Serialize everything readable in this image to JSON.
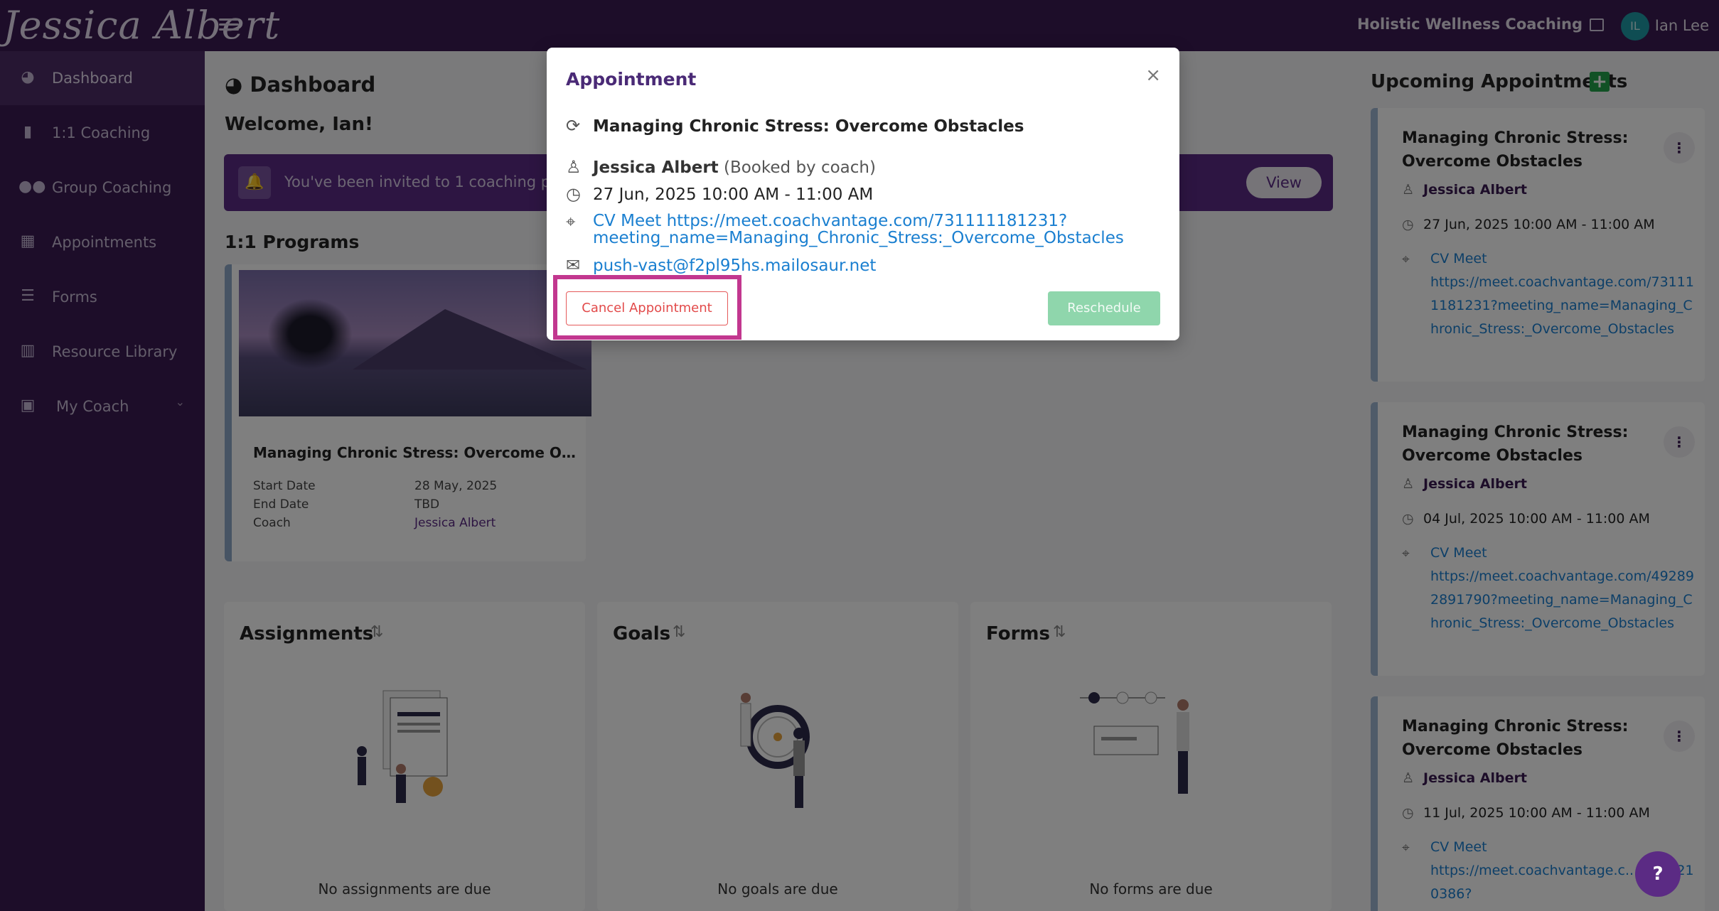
{
  "topbar": {
    "logo_text": "Jessica Albert",
    "org_name": "Holistic Wellness Coaching",
    "avatar_initials": "IL",
    "user_name": "Ian Lee"
  },
  "sidebar": {
    "items": [
      {
        "label": "Dashboard",
        "icon": "dashboard-icon"
      },
      {
        "label": "1:1 Coaching",
        "icon": "book-icon"
      },
      {
        "label": "Group Coaching",
        "icon": "group-icon"
      },
      {
        "label": "Appointments",
        "icon": "calendar-icon"
      },
      {
        "label": "Forms",
        "icon": "list-icon"
      },
      {
        "label": "Resource Library",
        "icon": "library-icon"
      },
      {
        "label": "My Coach",
        "icon": "coach-icon"
      }
    ]
  },
  "main": {
    "title": "Dashboard",
    "welcome": "Welcome, Ian!",
    "invite_message": "You've been invited to 1 coaching pr",
    "invite_button": "View",
    "programs_title": "1:1 Programs",
    "program": {
      "name": "Managing Chronic Stress: Overcome Obst...",
      "start_label": "Start Date",
      "start_value": "28 May, 2025",
      "end_label": "End Date",
      "end_value": "TBD",
      "coach_label": "Coach",
      "coach_value": "Jessica Albert"
    },
    "panels": {
      "assignments": {
        "title": "Assignments",
        "empty": "No assignments are due"
      },
      "goals": {
        "title": "Goals",
        "empty": "No goals are due"
      },
      "forms": {
        "title": "Forms",
        "empty": "No forms are due"
      }
    }
  },
  "upcoming": {
    "title": "Upcoming Appointments",
    "cards": [
      {
        "title": "Managing Chronic Stress: Overcome Obstacles",
        "coach": "Jessica Albert",
        "time": "27 Jun, 2025 10:00 AM - 11:00 AM",
        "location_name": "CV Meet",
        "location_url": "https://meet.coachvantage.com/731111181231?meeting_name=Managing_Chronic_Stress:_Overcome_Obstacles"
      },
      {
        "title": "Managing Chronic Stress: Overcome Obstacles",
        "coach": "Jessica Albert",
        "time": "04 Jul, 2025 10:00 AM - 11:00 AM",
        "location_name": "CV Meet",
        "location_url": "https://meet.coachvantage.com/492892891790?meeting_name=Managing_Chronic_Stress:_Overcome_Obstacles"
      },
      {
        "title": "Managing Chronic Stress: Overcome Obstacles",
        "coach": "Jessica Albert",
        "time": "11 Jul, 2025 10:00 AM - 11:00 AM",
        "location_name": "CV Meet",
        "location_url": "https://meet.coachvantage.c... 8260210386?"
      }
    ]
  },
  "modal": {
    "title": "Appointment",
    "session": "Managing Chronic Stress: Overcome Obstacles",
    "coach": "Jessica Albert",
    "booked_by": "(Booked by coach)",
    "time": "27 Jun, 2025 10:00 AM - 11:00 AM",
    "location_line1": "CV Meet https://meet.coachvantage.com/731111181231?",
    "location_line2": "meeting_name=Managing_Chronic_Stress:_Overcome_Obstacles",
    "email": "push-vast@f2pl95hs.mailosaur.net",
    "cancel_label": "Cancel Appointment",
    "reschedule_label": "Reschedule"
  },
  "help_label": "?",
  "colors": {
    "brand": "#3a1a52",
    "accent": "#5b2b84",
    "link": "#1a7fd0",
    "danger": "#e24a4a",
    "success_disabled": "#8fd6ac",
    "highlight": "#c2378f"
  }
}
